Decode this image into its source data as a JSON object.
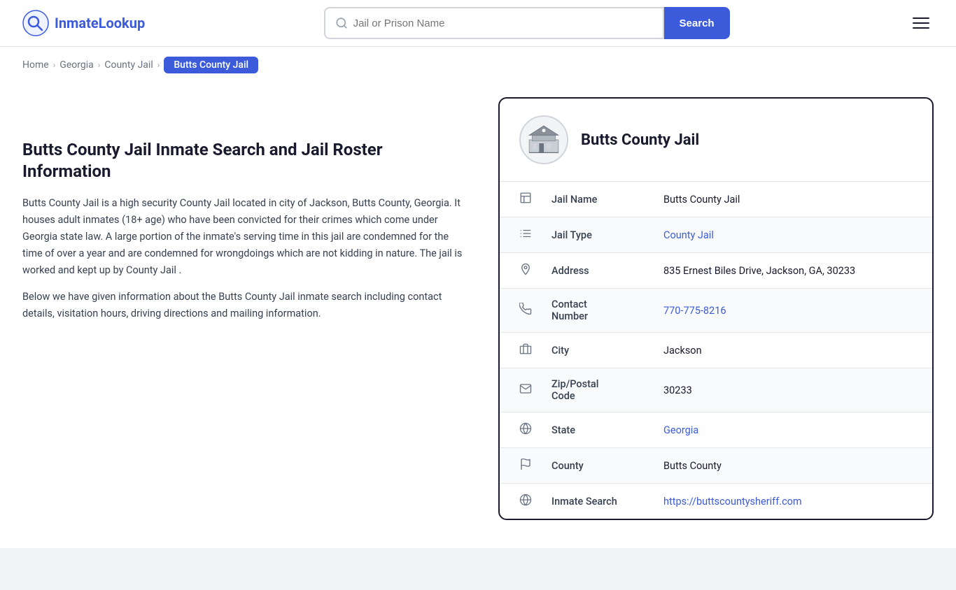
{
  "header": {
    "logo_brand": "InmateLookup",
    "logo_brand_first": "Inmate",
    "logo_brand_second": "Lookup",
    "search_placeholder": "Jail or Prison Name",
    "search_button_label": "Search"
  },
  "breadcrumb": {
    "items": [
      {
        "label": "Home",
        "href": "#"
      },
      {
        "label": "Georgia",
        "href": "#"
      },
      {
        "label": "County Jail",
        "href": "#"
      },
      {
        "label": "Butts County Jail",
        "current": true
      }
    ]
  },
  "main": {
    "page_title": "Butts County Jail Inmate Search and Jail Roster Information",
    "description_1": "Butts County Jail is a high security County Jail located in city of Jackson, Butts County, Georgia. It houses adult inmates (18+ age) who have been convicted for their crimes which come under Georgia state law. A large portion of the inmate's serving time in this jail are condemned for the time of over a year and are condemned for wrongdoings which are not kidding in nature. The jail is worked and kept up by County Jail .",
    "description_2": "Below we have given information about the Butts County Jail inmate search including contact details, visitation hours, driving directions and mailing information."
  },
  "info_card": {
    "title": "Butts County Jail",
    "rows": [
      {
        "icon": "jail",
        "label": "Jail Name",
        "value": "Butts County Jail",
        "link": null
      },
      {
        "icon": "type",
        "label": "Jail Type",
        "value": "County Jail",
        "link": "#"
      },
      {
        "icon": "address",
        "label": "Address",
        "value": "835 Ernest Biles Drive, Jackson, GA, 30233",
        "link": null
      },
      {
        "icon": "phone",
        "label": "Contact Number",
        "value": "770-775-8216",
        "link": "tel:770-775-8216"
      },
      {
        "icon": "city",
        "label": "City",
        "value": "Jackson",
        "link": null
      },
      {
        "icon": "zip",
        "label": "Zip/Postal Code",
        "value": "30233",
        "link": null
      },
      {
        "icon": "state",
        "label": "State",
        "value": "Georgia",
        "link": "#"
      },
      {
        "icon": "county",
        "label": "County",
        "value": "Butts County",
        "link": null
      },
      {
        "icon": "web",
        "label": "Inmate Search",
        "value": "https://buttscountysheriff.com",
        "link": "https://buttscountysheriff.com"
      }
    ]
  }
}
